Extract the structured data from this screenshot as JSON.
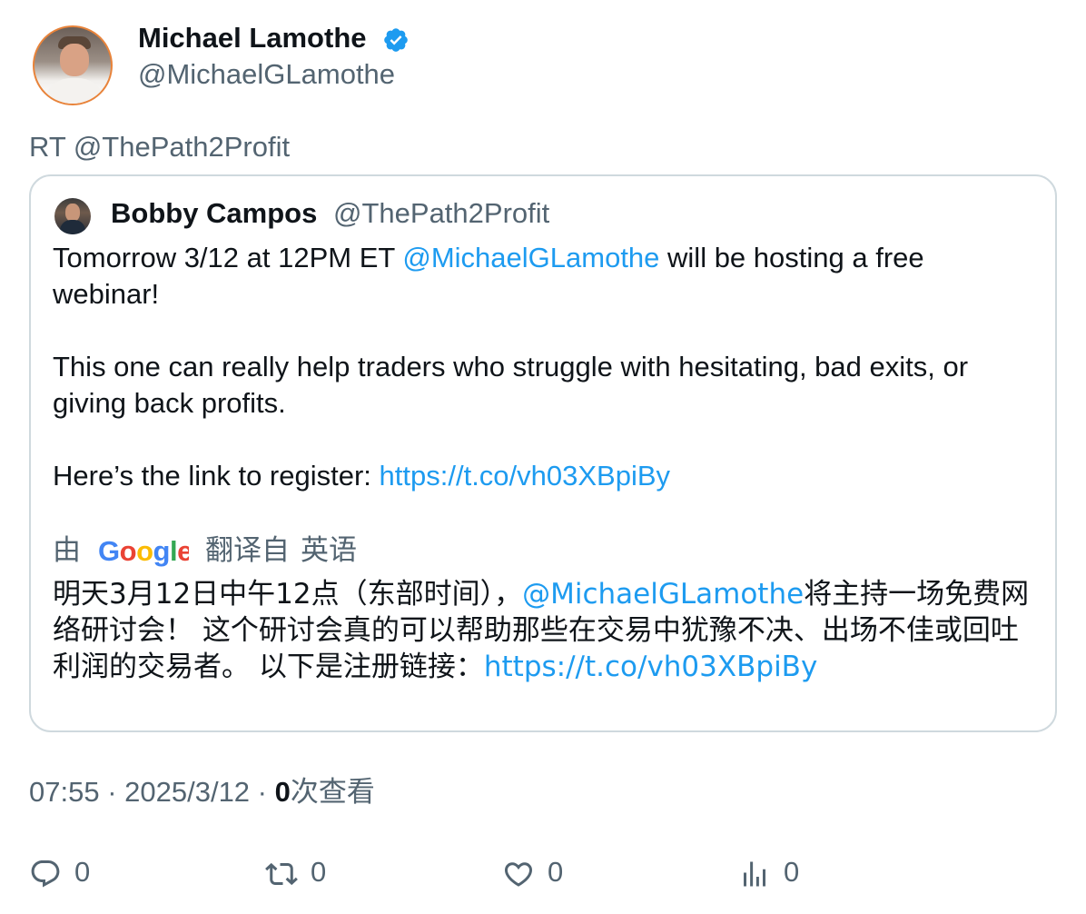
{
  "author": {
    "name": "Michael Lamothe",
    "handle": "@MichaelGLamothe",
    "verified": true,
    "verified_color": "#1d9bf0"
  },
  "retweet_label": "RT @ThePath2Profit",
  "quoted": {
    "name": "Bobby Campos",
    "handle": "@ThePath2Profit",
    "line1_prefix": "Tomorrow 3/12 at 12PM ET ",
    "line1_mention": "@MichaelGLamothe",
    "line1_suffix": " will be hosting a free webinar!",
    "para2": "This one can really help traders who struggle with hesitating, bad exits, or giving back profits.",
    "para3_prefix": "Here’s the link to register: ",
    "para3_link": "https://t.co/vh03XBpiBy",
    "translation": {
      "by": "由",
      "provider": "Google",
      "translated_from": "翻译自",
      "language": "英语"
    },
    "zh_prefix": "明天3月12日中午12点（东部时间），",
    "zh_mention": "@MichaelGLamothe",
    "zh_middle": "将主持一场免费网络研讨会！ 这个研讨会真的可以帮助那些在交易中犹豫不决、出场不佳或回吐利润的交易者。 以下是注册链接：",
    "zh_link": "https://t.co/vh03XBpiBy"
  },
  "meta": {
    "time": "07:55",
    "sep": " · ",
    "date": "2025/3/12",
    "views": "0",
    "views_label": "次查看"
  },
  "actions": {
    "replies": "0",
    "retweets": "0",
    "likes": "0",
    "views": "0"
  },
  "colors": {
    "link": "#1d9bf0",
    "secondary_text": "#536471",
    "border": "#cfd9de"
  }
}
